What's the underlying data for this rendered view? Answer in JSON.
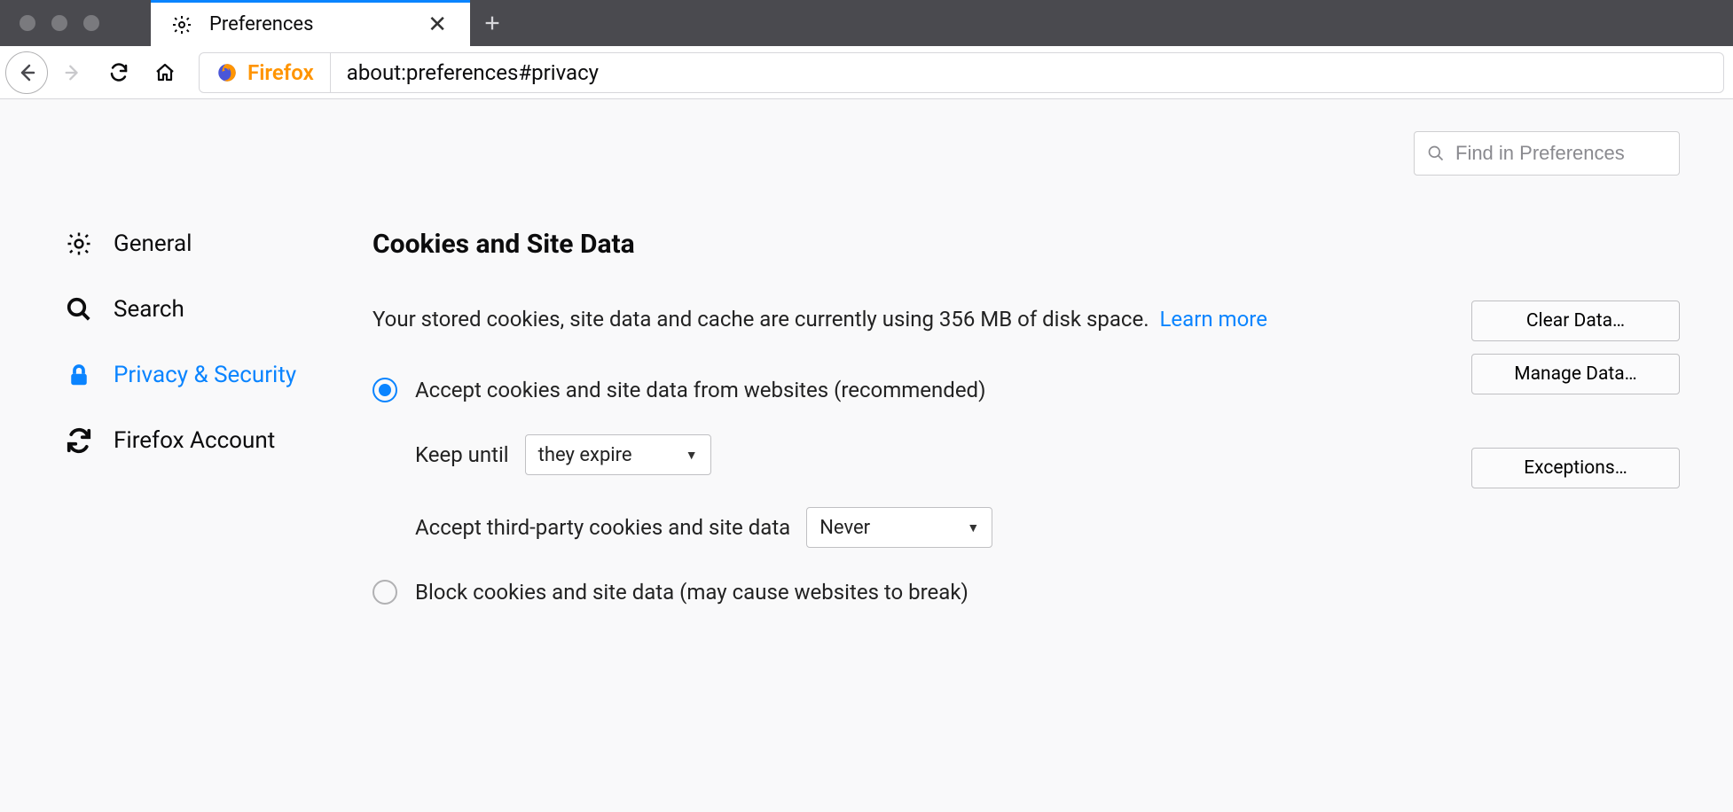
{
  "tab": {
    "title": "Preferences"
  },
  "urlbar": {
    "brand": "Firefox",
    "url": "about:preferences#privacy"
  },
  "search": {
    "placeholder": "Find in Preferences"
  },
  "sidebar": {
    "general": "General",
    "search": "Search",
    "privacy": "Privacy & Security",
    "account": "Firefox Account"
  },
  "section": {
    "title": "Cookies and Site Data",
    "desc": "Your stored cookies, site data and cache are currently using 356 MB of disk space.",
    "learn": "Learn more"
  },
  "buttons": {
    "clear": "Clear Data…",
    "manage": "Manage Data…",
    "exceptions": "Exceptions…"
  },
  "options": {
    "accept": "Accept cookies and site data from websites (recommended)",
    "keep_label": "Keep until",
    "keep_value": "they expire",
    "third_label": "Accept third-party cookies and site data",
    "third_value": "Never",
    "block": "Block cookies and site data (may cause websites to break)"
  }
}
